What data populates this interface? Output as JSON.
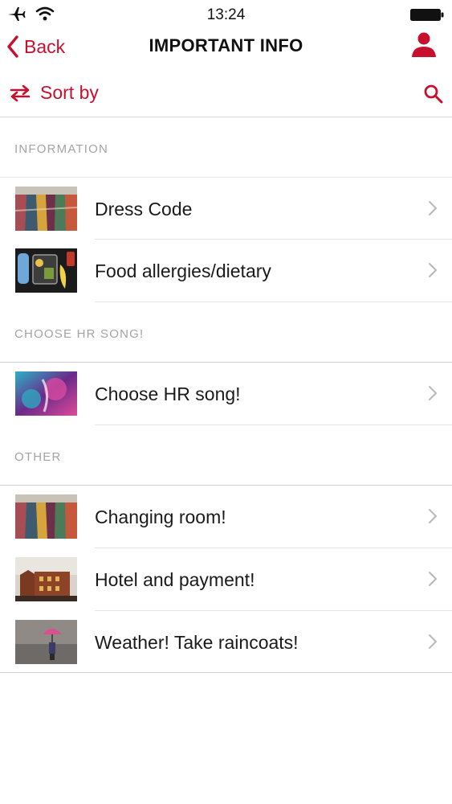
{
  "status": {
    "time": "13:24"
  },
  "nav": {
    "back_label": "Back",
    "title": "IMPORTANT INFO"
  },
  "toolbar": {
    "sort_label": "Sort by"
  },
  "sections": [
    {
      "header": "INFORMATION",
      "items": [
        {
          "label": "Dress Code",
          "thumb": "clothes-rack"
        },
        {
          "label": "Food allergies/dietary",
          "thumb": "lunchbox"
        }
      ]
    },
    {
      "header": "CHOOSE HR SONG!",
      "items": [
        {
          "label": "Choose HR song!",
          "thumb": "colorful-music"
        }
      ]
    },
    {
      "header": "OTHER",
      "items": [
        {
          "label": "Changing room!",
          "thumb": "clothes-rack"
        },
        {
          "label": "Hotel and payment!",
          "thumb": "hotel-building"
        },
        {
          "label": "Weather! Take raincoats!",
          "thumb": "umbrella-rain"
        }
      ]
    }
  ],
  "colors": {
    "accent": "#c8102e",
    "section_text": "#a3a3a3",
    "separator": "#d9d9d9"
  }
}
